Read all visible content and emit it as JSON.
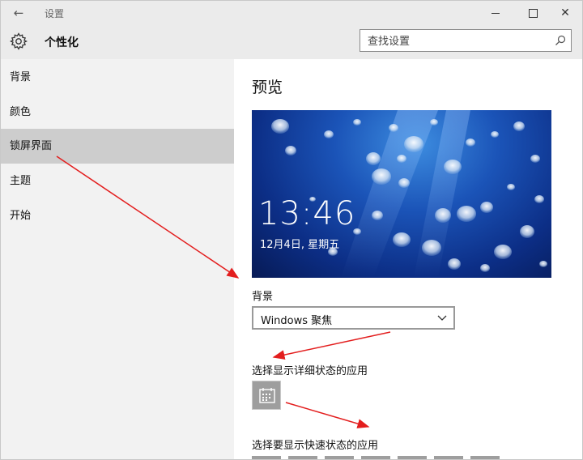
{
  "window": {
    "title": "设置"
  },
  "header": {
    "title": "个性化",
    "search_placeholder": "查找设置"
  },
  "sidebar": {
    "items": [
      {
        "label": "背景"
      },
      {
        "label": "颜色"
      },
      {
        "label": "锁屏界面"
      },
      {
        "label": "主题"
      },
      {
        "label": "开始"
      }
    ],
    "selected_index": 2
  },
  "main": {
    "preview_title": "预览",
    "lock_time": "13:46",
    "lock_date": "12月4日, 星期五",
    "background_label": "背景",
    "background_value": "Windows 聚焦",
    "detail_label": "选择显示详细状态的应用",
    "quick_label": "选择要显示快速状态的应用"
  },
  "colors": {
    "accent_annotation": "#e31e1e",
    "selected_nav": "#cdcdcd",
    "sidebar_bg": "#f2f2f2",
    "titlebar_bg": "#ebebeb"
  },
  "icons": {
    "back": "arrow-left-icon",
    "settings": "gear-icon",
    "search": "search-icon",
    "dropdown": "chevron-down-icon",
    "calendar": "calendar-icon"
  }
}
